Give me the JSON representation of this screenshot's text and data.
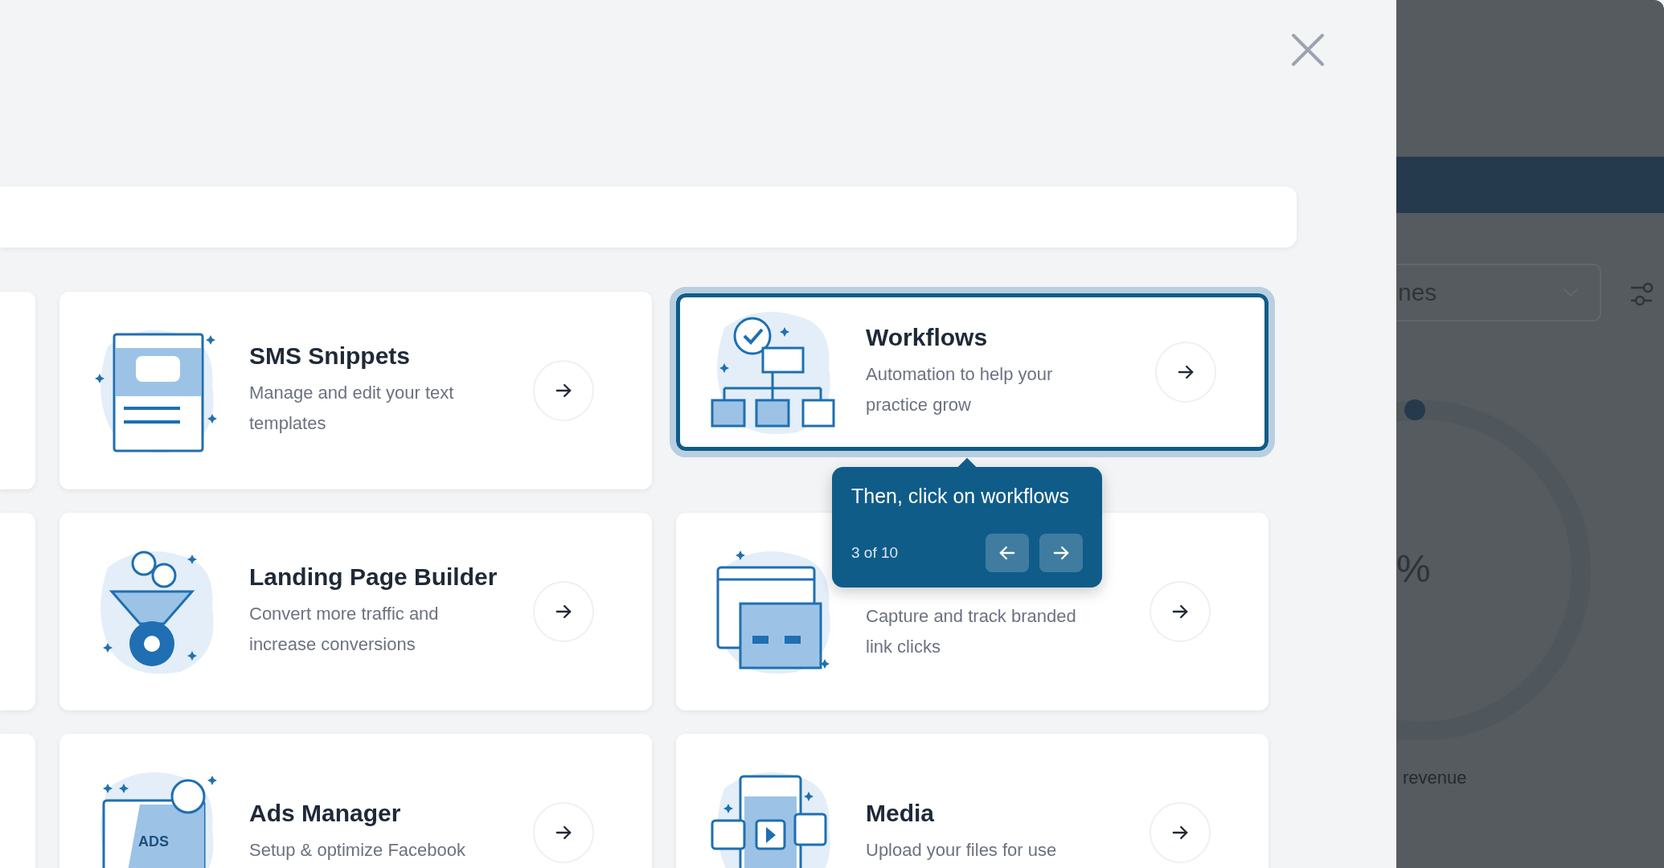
{
  "cards": [
    {
      "kind": "sms",
      "title": "SMS Snippets",
      "description": "Manage and edit your text templates",
      "highlighted": false
    },
    {
      "kind": "workflow",
      "title": "Workflows",
      "description": "Automation to help your practice grow",
      "highlighted": true
    },
    {
      "kind": "funnel",
      "title": "Landing Page Builder",
      "description": "Convert more traffic and increase conversions",
      "highlighted": false
    },
    {
      "kind": "links",
      "description": "Capture and track branded link clicks",
      "highlighted": false
    },
    {
      "kind": "ads",
      "title": "Ads Manager",
      "description": "Setup & optimize Facebook",
      "art_label": "ADS",
      "highlighted": false
    },
    {
      "kind": "media",
      "title": "Media",
      "description": "Upload your files for use",
      "highlighted": false
    }
  ],
  "tour": {
    "text": "Then, click on workflows",
    "step": "3 of 10"
  },
  "background": {
    "dropdown": "nes",
    "percent": "%",
    "caption": "revenue"
  }
}
